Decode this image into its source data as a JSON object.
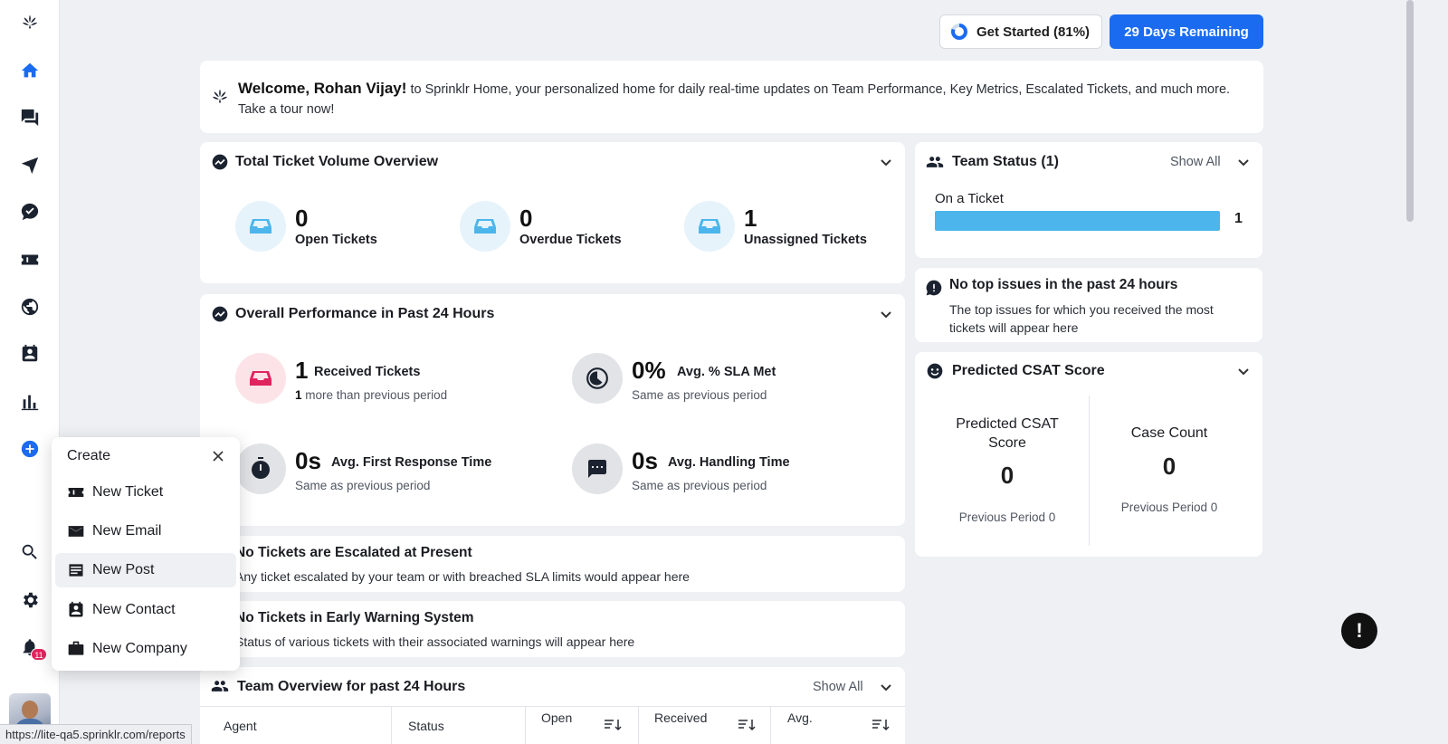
{
  "header": {
    "get_started_label": "Get Started (81%)",
    "get_started_progress": 81,
    "trial_label": "29 Days Remaining"
  },
  "welcome": {
    "greeting": "Welcome, Rohan Vijay!",
    "text": " to Sprinklr Home, your personalized home for daily real-time updates on Team Performance, Key Metrics, Escalated Tickets, and much more. Take a tour now!"
  },
  "ticket_volume": {
    "title": "Total Ticket Volume Overview",
    "metrics": [
      {
        "value": "0",
        "label": "Open Tickets"
      },
      {
        "value": "0",
        "label": "Overdue Tickets"
      },
      {
        "value": "1",
        "label": "Unassigned Tickets"
      }
    ]
  },
  "performance": {
    "title": "Overall Performance in Past 24 Hours",
    "metrics": [
      {
        "value": "1",
        "label": "Received Tickets",
        "sub_bold": "1",
        "sub": " more than previous period"
      },
      {
        "value": "0%",
        "label": "Avg. % SLA Met",
        "sub": "Same as previous period"
      },
      {
        "value": "0s",
        "label": "Avg. First Response Time",
        "sub": "Same as previous period"
      },
      {
        "value": "0s",
        "label": "Avg. Handling Time",
        "sub": "Same as previous period"
      }
    ]
  },
  "escalated": {
    "title": "No Tickets are Escalated at Present",
    "text": "Any ticket escalated by your team or with breached SLA limits would appear here"
  },
  "early_warning": {
    "title": "No Tickets in Early Warning System",
    "text": "Status of various tickets with their associated warnings will appear here"
  },
  "team_overview": {
    "title": "Team Overview for past 24 Hours",
    "show_all": "Show All",
    "columns": [
      "Agent",
      "Status",
      "Open",
      "Received",
      "Avg."
    ]
  },
  "team_status": {
    "title": "Team Status (1)",
    "show_all": "Show All",
    "bar_label": "On a Ticket",
    "bar_value": "1",
    "bar_fill": 1.0
  },
  "top_issues": {
    "title": "No top issues in the past 24 hours",
    "text": "The top issues for which you received the most tickets will appear here"
  },
  "csat": {
    "title": "Predicted CSAT Score",
    "score_label": "Predicted CSAT Score",
    "score_value": "0",
    "score_prev": "Previous Period 0",
    "count_label": "Case Count",
    "count_value": "0",
    "count_prev": "Previous Period 0"
  },
  "create_menu": {
    "title": "Create",
    "items": [
      "New Ticket",
      "New Email",
      "New Post",
      "New Contact",
      "New Company"
    ]
  },
  "notifications": {
    "count": "11"
  },
  "status_url": "https://lite-qa5.sprinklr.com/reports",
  "help_fab": "!",
  "colors": {
    "accent": "#1a6bf0",
    "bar": "#4cb6ec",
    "badge": "#e0245e"
  }
}
